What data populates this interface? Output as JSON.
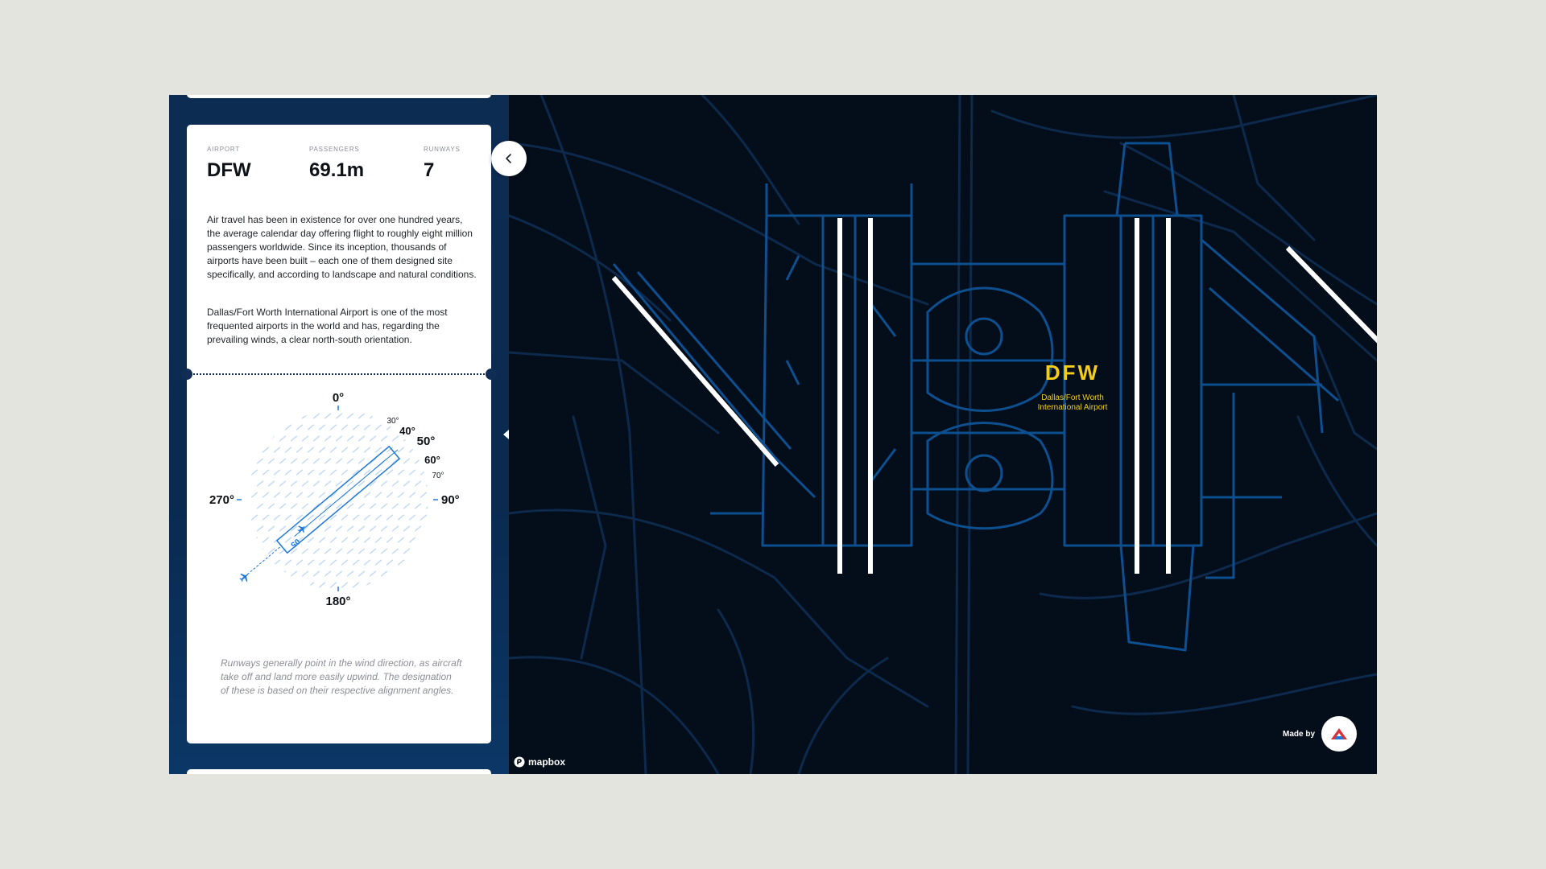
{
  "stats": [
    {
      "label": "AIRPORT",
      "value": "DFW"
    },
    {
      "label": "PASSENGERS",
      "value": "69.1m"
    },
    {
      "label": "RUNWAYS",
      "value": "7"
    }
  ],
  "paragraphs": [
    "Air travel has been in existence for over one hundred years, the average calendar day offering flight to roughly eight million passengers worldwide. Since its inception, thousands of airports have been built – each one of them designed site specifically, and according to landscape and natural conditions.",
    "Dallas/Fort Worth International Airport is one of the most frequented airports in the world and has, regarding the prevailing winds, a clear north-south orientation."
  ],
  "compass": {
    "north": "0°",
    "east": "90°",
    "south": "180°",
    "west": "270°",
    "angles": [
      "30°",
      "40°",
      "50°",
      "60°",
      "70°"
    ],
    "runway_designation": "05",
    "runway_bearing_deg": 50
  },
  "caption": "Runways generally point in the wind direction, as aircraft take off and land more easily upwind. The designation of these is based on their respective alignment angles.",
  "map": {
    "airport_code": "DFW",
    "airport_name_line1": "Dallas/Fort Worth",
    "airport_name_line2": "International Airport",
    "attribution": "mapbox",
    "made_by": "Made by"
  },
  "colors": {
    "map_bg": "#040d1a",
    "taxiway": "#0d4f8f",
    "runway": "#ffffff",
    "label": "#f4cc1c",
    "compass_accent": "#1f78d8",
    "sidebar": "#0c2c52"
  },
  "icons": {
    "collapse": "chevron-left-icon",
    "plane": "plane-icon",
    "mapbox": "mapbox-logo-icon",
    "studio": "studio-logo-icon"
  }
}
